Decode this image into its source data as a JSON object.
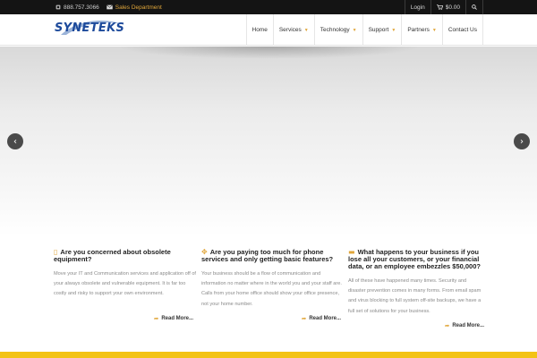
{
  "topbar": {
    "phone_icon": "phone-icon",
    "phone": "888.757.3066",
    "mail_icon": "envelope-icon",
    "sales": "Sales Department",
    "login": "Login",
    "cart_icon": "cart-icon",
    "cart_total": "$0.00",
    "search_icon": "search-icon"
  },
  "header": {
    "logo_text": "SYNETEKS",
    "nav": [
      {
        "label": "Home"
      },
      {
        "label": "Services"
      },
      {
        "label": "Technology"
      },
      {
        "label": "Support"
      },
      {
        "label": "Partners"
      },
      {
        "label": "Contact Us"
      }
    ]
  },
  "hero": {
    "prev_icon": "chevron-left-icon",
    "next_icon": "chevron-right-icon"
  },
  "features": [
    {
      "icon": "tablet-icon",
      "title": "Are you concerned about obsolete equipment?",
      "body": "Move your IT and Communication services and application off of your always obsolete and vulnerable equipment. It is far too costly and risky to support your own environment.",
      "more": "Read More..."
    },
    {
      "icon": "arrows-icon",
      "title": "Are you paying too much for phone services and only getting basic features?",
      "body": "Your business should be a flow of communication and information no matter where in the world you and your staff are. Calls from your home office should show your office presence, not your home number.",
      "more": "Read More..."
    },
    {
      "icon": "folder-icon",
      "title": "What happens to your business if you lose all your customers, or your financial data, or an employee embezzles $50,000?",
      "body": "All of these have happened many times. Security and disaster prevention comes in many forms. From email spam and virus blocking to full system off-site backups, we have a full set of solutions for your business.",
      "more": "Read More..."
    }
  ],
  "colors": {
    "accent": "#e0a63a",
    "topbar_bg": "#141414",
    "logo_blue": "#1d4a9b",
    "footer_bar": "#f3c316"
  }
}
